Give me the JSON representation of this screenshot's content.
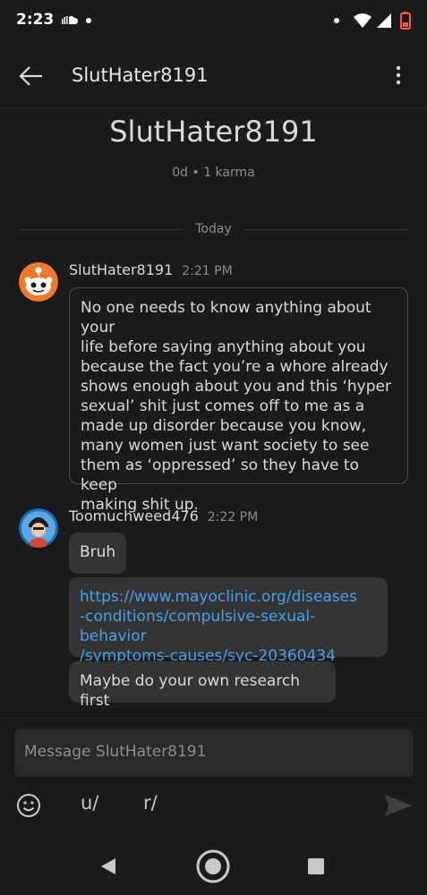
{
  "status_bar": {
    "time": "2:23"
  },
  "header": {
    "title": "SlutHater8191"
  },
  "profile": {
    "name": "SlutHater8191",
    "meta": "0d • 1 karma"
  },
  "date_divider": "Today",
  "messages": [
    {
      "author": "SlutHater8191",
      "time": "2:21 PM",
      "avatar": "reddit-snoo-orange",
      "lines": [
        "No one needs to know anything about your",
        "life before saying anything about you",
        "because the fact you’re a whore already",
        "shows enough about you and this ‘hyper",
        "sexual’ shit just comes off to me as a",
        "made up disorder because you know,",
        "many women just want society to see",
        "them as ‘oppressed’ so they have to keep",
        "making shit up."
      ]
    },
    {
      "author": "Toomuchweed476",
      "time": "2:22 PM",
      "avatar": "blue-avatar",
      "bubbles": [
        {
          "text": "Bruh"
        },
        {
          "link_lines": [
            "https://www.mayoclinic.org/diseases",
            "-conditions/compulsive-sexual-behavior",
            "/symptoms-causes/syc-20360434"
          ]
        },
        {
          "text": "Maybe do your own research first"
        }
      ]
    }
  ],
  "composer": {
    "placeholder": "Message SlutHater8191",
    "tools": [
      "u/",
      "r/"
    ]
  },
  "colors": {
    "background": "#1b1b1b",
    "bubble": "#333435",
    "link": "#4a9fe8",
    "avatar_orange": "#f0782d",
    "avatar_blue": "#1e6fb8"
  }
}
